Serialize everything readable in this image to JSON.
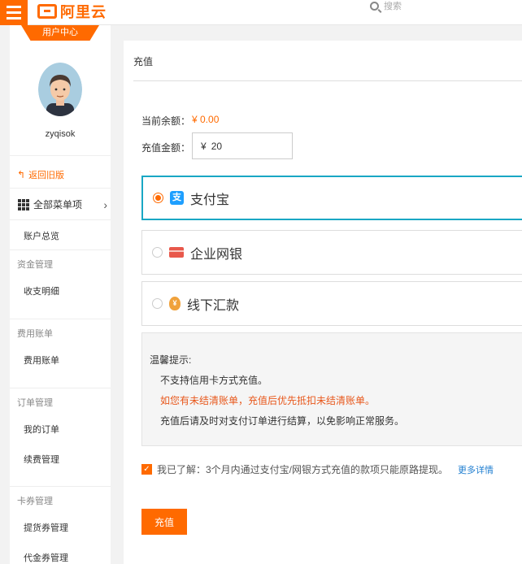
{
  "topbar": {
    "logo_text": "阿里云",
    "search_placeholder": "搜索"
  },
  "sidebar": {
    "user_center_tab": "用户中心",
    "username": "zyqisok",
    "back_old": "返回旧版",
    "all_menu": "全部菜单项",
    "items": [
      {
        "type": "item",
        "label": "账户总览"
      },
      {
        "type": "group",
        "label": "资金管理"
      },
      {
        "type": "item",
        "label": "收支明细"
      },
      {
        "type": "group",
        "label": "费用账单"
      },
      {
        "type": "item",
        "label": "费用账单"
      },
      {
        "type": "group",
        "label": "订单管理"
      },
      {
        "type": "item",
        "label": "我的订单"
      },
      {
        "type": "item",
        "label": "续费管理"
      },
      {
        "type": "group",
        "label": "卡券管理"
      },
      {
        "type": "item",
        "label": "提货券管理"
      },
      {
        "type": "item",
        "label": "代金券管理"
      }
    ]
  },
  "main": {
    "title": "充值",
    "balance_label": "当前余额：",
    "balance_value": "¥ 0.00",
    "amount_label": "充值金额：",
    "currency": "¥",
    "amount_value": "20",
    "pay_options": [
      {
        "label": "支付宝",
        "icon": "alipay-icon",
        "icon_glyph": "支",
        "selected": true
      },
      {
        "label": "企业网银",
        "icon": "bank-card-icon",
        "selected": false
      },
      {
        "label": "线下汇款",
        "icon": "offline-remit-icon",
        "icon_glyph": "¥",
        "selected": false
      }
    ],
    "tips": {
      "title": "温馨提示:",
      "lines": [
        "不支持信用卡方式充值。",
        "如您有未结清账单，充值后优先抵扣未结清账单。",
        "充值后请及时对支付订单进行结算，以免影响正常服务。"
      ]
    },
    "agreement_text": "我已了解：3个月内通过支付宝/网银方式充值的款项只能原路提现。",
    "agreement_checked": true,
    "more_link": "更多详情",
    "submit_label": "充值"
  },
  "colors": {
    "accent": "#ff6a00",
    "selected_border": "#19a7c4",
    "link": "#1f7ed0",
    "warning_text": "#e8581c"
  }
}
